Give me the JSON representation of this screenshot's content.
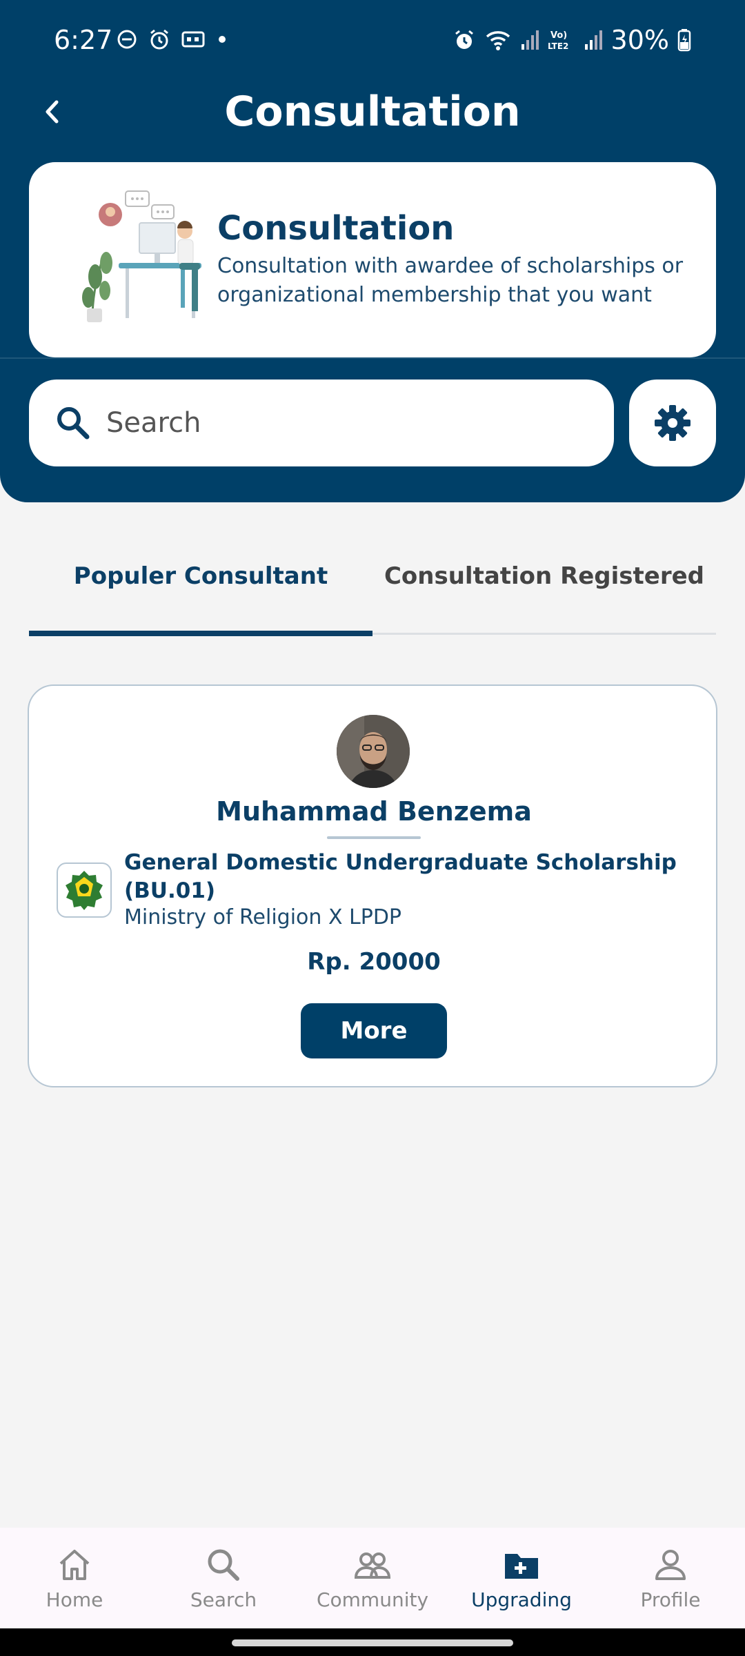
{
  "status_bar": {
    "time": "6:27",
    "battery": "30%",
    "icons": [
      "dnd-icon",
      "alarm-icon",
      "cast-icon",
      "dot-icon",
      "alarm-icon",
      "wifi-icon",
      "signal-icon",
      "volte-icon",
      "signal-icon",
      "battery-icon"
    ]
  },
  "header": {
    "title": "Consultation",
    "back_icon": "chevron-left-icon"
  },
  "hero": {
    "title": "Consultation",
    "description": "Consultation with awardee of scholarships or organizational membership that you want"
  },
  "search": {
    "placeholder": "Search",
    "value": ""
  },
  "filter": {
    "icon": "gear-icon"
  },
  "tabs": [
    {
      "label": "Populer Consultant",
      "active": true
    },
    {
      "label": "Consultation Registered",
      "active": false
    }
  ],
  "consultant": {
    "name": "Muhammad Benzema",
    "scholarship": "General Domestic Undergraduate  Scholarship (BU.01)",
    "organization": "Ministry of Religion X LPDP",
    "price": "Rp. 20000",
    "more_label": "More"
  },
  "bottom_nav": [
    {
      "label": "Home",
      "icon": "home-icon",
      "active": false
    },
    {
      "label": "Search",
      "icon": "search-icon",
      "active": false
    },
    {
      "label": "Community",
      "icon": "community-icon",
      "active": false
    },
    {
      "label": "Upgrading",
      "icon": "folder-plus-icon",
      "active": true
    },
    {
      "label": "Profile",
      "icon": "profile-icon",
      "active": false
    }
  ],
  "colors": {
    "primary": "#004068",
    "background": "#f4f4f4",
    "inactive": "#8a8a8a"
  }
}
